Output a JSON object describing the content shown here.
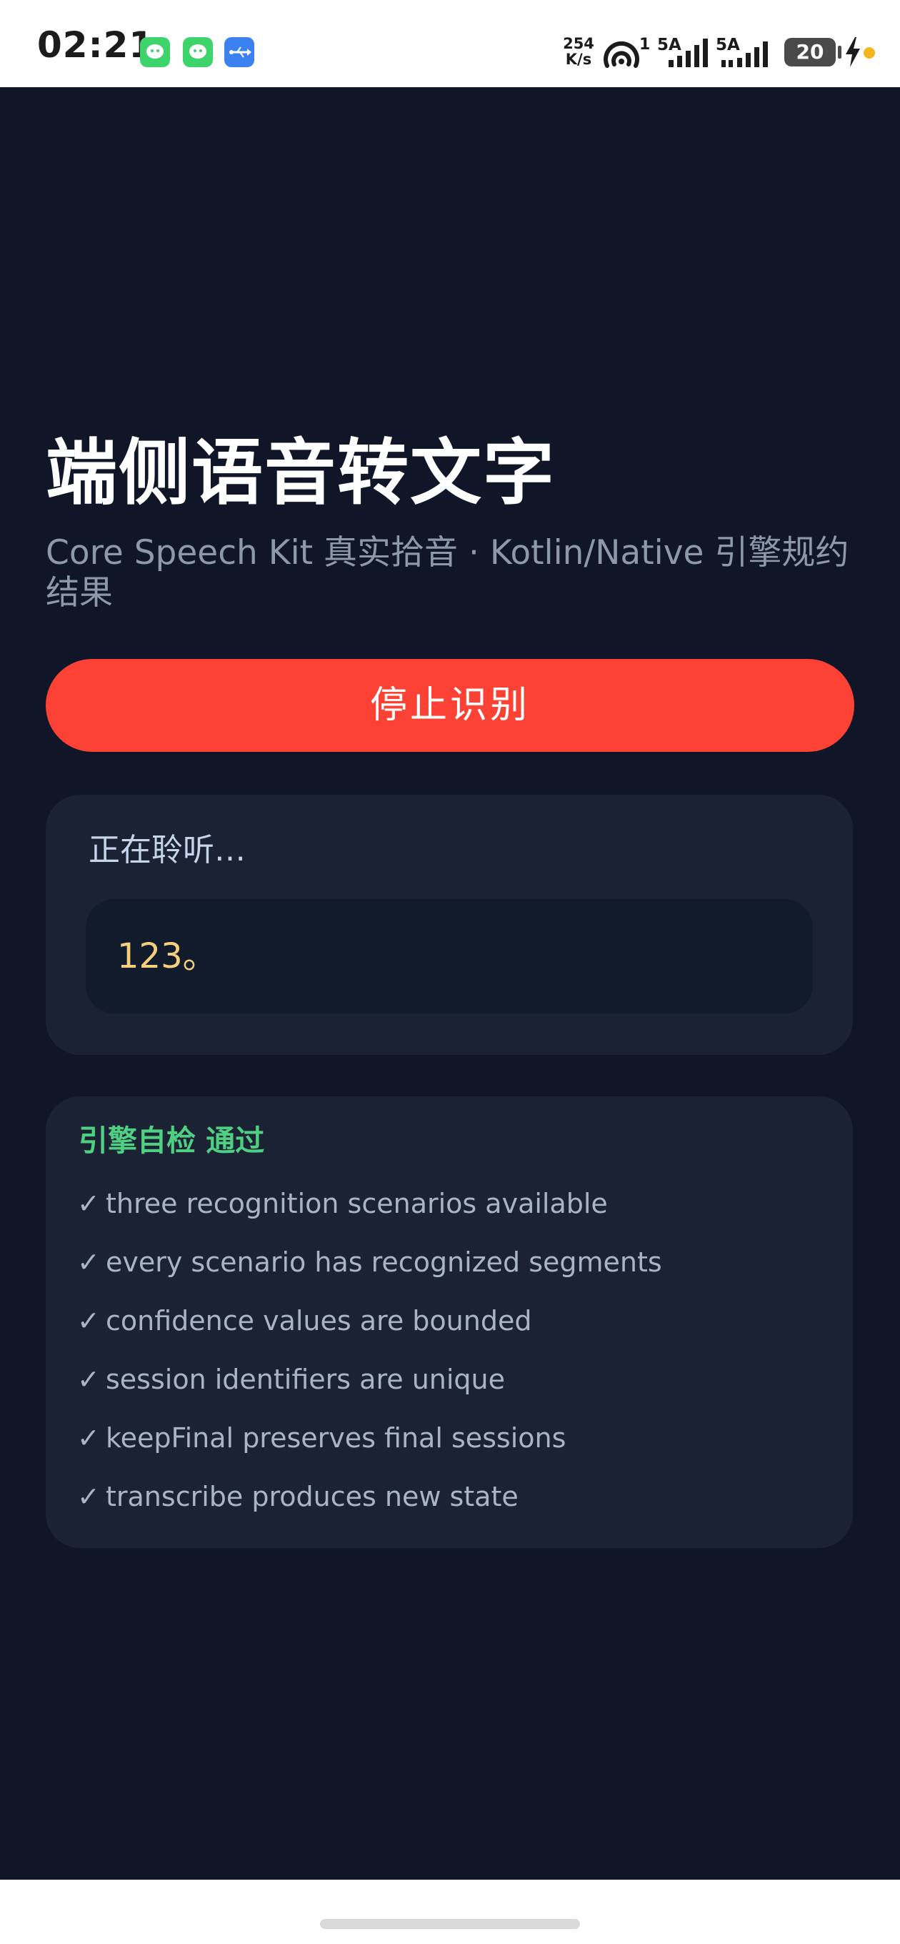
{
  "status_bar": {
    "time": "02:21",
    "net_speed_value": "254",
    "net_speed_unit": "K/s",
    "hotspot_count": "1",
    "sim1_label": "5A",
    "sim2_label": "5A",
    "battery_level": "20",
    "notification_icons": [
      "wechat-icon",
      "wechat-icon",
      "usb-icon"
    ],
    "charge_dot_color": "#f3b61f"
  },
  "header": {
    "title": "端侧语音转文字",
    "subtitle": "Core Speech Kit 真实拾音 · Kotlin/Native 引擎规约结果"
  },
  "actions": {
    "stop_label": "停止识别",
    "stop_color": "#fb4235"
  },
  "listening": {
    "status": "正在聆听…",
    "transcript": "123。"
  },
  "self_check": {
    "title": "引擎自检 通过",
    "check_mark": "✓",
    "items": [
      "three recognition scenarios available",
      "every scenario has recognized segments",
      "confidence values are bounded",
      "session identifiers are unique",
      "keepFinal preserves final sessions",
      "transcribe produces new state"
    ]
  },
  "colors": {
    "background": "#101628",
    "card": "#1b2234",
    "pass": "#4fcf82",
    "transcript": "#f5cf7c"
  }
}
